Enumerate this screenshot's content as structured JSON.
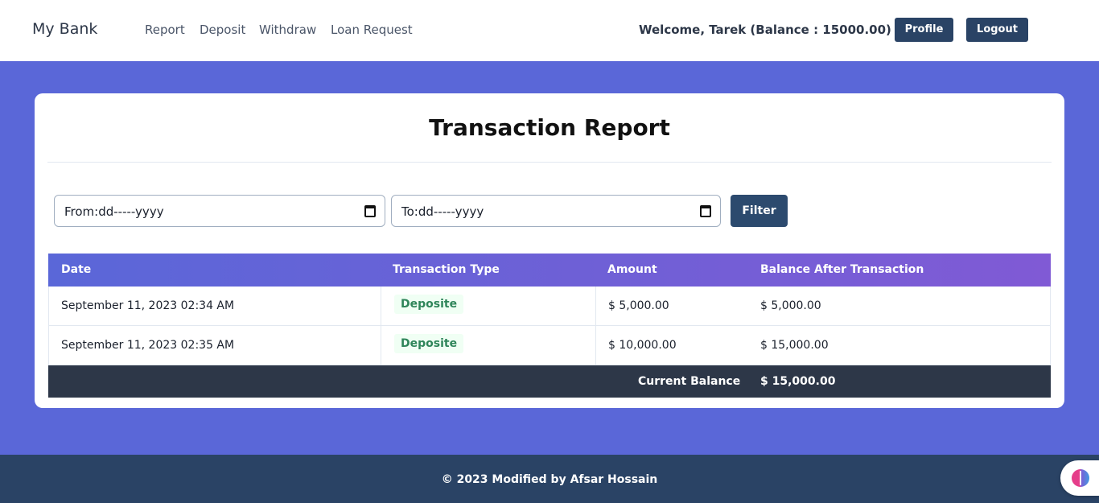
{
  "nav": {
    "brand": "My Bank",
    "links": [
      "Report",
      "Deposit",
      "Withdraw",
      "Loan Request"
    ],
    "welcome": "Welcome, Tarek (Balance : 15000.00)",
    "profile_label": "Profile",
    "logout_label": "Logout"
  },
  "report": {
    "title": "Transaction Report",
    "from_value": "From:dd-----yyyy",
    "to_value": "To:dd-----yyyy",
    "filter_label": "Filter",
    "columns": [
      "Date",
      "Transaction Type",
      "Amount",
      "Balance After Transaction"
    ],
    "rows": [
      {
        "date": "September 11, 2023 02:34 AM",
        "type": "Deposite",
        "amount": "$ 5,000.00",
        "balance": "$ 5,000.00"
      },
      {
        "date": "September 11, 2023 02:35 AM",
        "type": "Deposite",
        "amount": "$ 10,000.00",
        "balance": "$ 15,000.00"
      }
    ],
    "current_balance_label": "Current Balance",
    "current_balance_value": "$ 15,000.00"
  },
  "footer": {
    "text": "© 2023 Modified by Afsar Hossain"
  },
  "colors": {
    "page_background": "#5a67d8",
    "nav_button": "#2a4365",
    "header_gradient_start": "#5a67d8",
    "header_gradient_end": "#805ad5",
    "deposit_badge_text": "#2f855a"
  },
  "icons": [
    "calendar-icon",
    "brain-extension-icon"
  ]
}
